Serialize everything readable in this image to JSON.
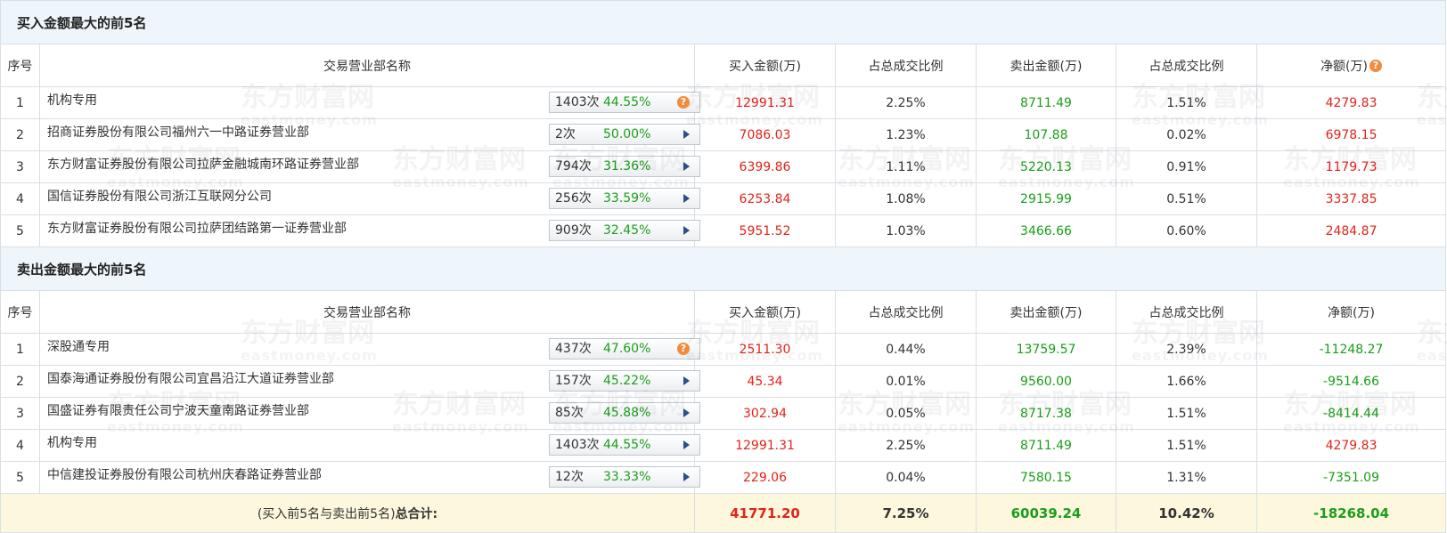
{
  "buy_section": {
    "title": "买入金额最大的前5名",
    "headers": {
      "idx": "序号",
      "name": "交易营业部名称",
      "buy": "买入金额(万)",
      "buy_pct": "占总成交比例",
      "sell": "卖出金额(万)",
      "sell_pct": "占总成交比例",
      "net": "净额(万)"
    },
    "rows": [
      {
        "idx": "1",
        "name": "机构专用",
        "count": "1403次",
        "rate": "44.55%",
        "buy": "12991.31",
        "buy_pct": "2.25%",
        "sell": "8711.49",
        "sell_pct": "1.51%",
        "net": "4279.83"
      },
      {
        "idx": "2",
        "name": "招商证券股份有限公司福州六一中路证券营业部",
        "count": "2次",
        "rate": "50.00%",
        "buy": "7086.03",
        "buy_pct": "1.23%",
        "sell": "107.88",
        "sell_pct": "0.02%",
        "net": "6978.15"
      },
      {
        "idx": "3",
        "name": "东方财富证券股份有限公司拉萨金融城南环路证券营业部",
        "count": "794次",
        "rate": "31.36%",
        "buy": "6399.86",
        "buy_pct": "1.11%",
        "sell": "5220.13",
        "sell_pct": "0.91%",
        "net": "1179.73"
      },
      {
        "idx": "4",
        "name": "国信证券股份有限公司浙江互联网分公司",
        "count": "256次",
        "rate": "33.59%",
        "buy": "6253.84",
        "buy_pct": "1.08%",
        "sell": "2915.99",
        "sell_pct": "0.51%",
        "net": "3337.85"
      },
      {
        "idx": "5",
        "name": "东方财富证券股份有限公司拉萨团结路第一证券营业部",
        "count": "909次",
        "rate": "32.45%",
        "buy": "5951.52",
        "buy_pct": "1.03%",
        "sell": "3466.66",
        "sell_pct": "0.60%",
        "net": "2484.87"
      }
    ]
  },
  "sell_section": {
    "title": "卖出金额最大的前5名",
    "headers": {
      "idx": "序号",
      "name": "交易营业部名称",
      "buy": "买入金额(万)",
      "buy_pct": "占总成交比例",
      "sell": "卖出金额(万)",
      "sell_pct": "占总成交比例",
      "net": "净额(万)"
    },
    "rows": [
      {
        "idx": "1",
        "name": "深股通专用",
        "count": "437次",
        "rate": "47.60%",
        "buy": "2511.30",
        "buy_pct": "0.44%",
        "sell": "13759.57",
        "sell_pct": "2.39%",
        "net": "-11248.27"
      },
      {
        "idx": "2",
        "name": "国泰海通证券股份有限公司宜昌沿江大道证券营业部",
        "count": "157次",
        "rate": "45.22%",
        "buy": "45.34",
        "buy_pct": "0.01%",
        "sell": "9560.00",
        "sell_pct": "1.66%",
        "net": "-9514.66"
      },
      {
        "idx": "3",
        "name": "国盛证券有限责任公司宁波天童南路证券营业部",
        "count": "85次",
        "rate": "45.88%",
        "buy": "302.94",
        "buy_pct": "0.05%",
        "sell": "8717.38",
        "sell_pct": "1.51%",
        "net": "-8414.44"
      },
      {
        "idx": "4",
        "name": "机构专用",
        "count": "1403次",
        "rate": "44.55%",
        "buy": "12991.31",
        "buy_pct": "2.25%",
        "sell": "8711.49",
        "sell_pct": "1.51%",
        "net": "4279.83"
      },
      {
        "idx": "5",
        "name": "中信建投证券股份有限公司杭州庆春路证券营业部",
        "count": "12次",
        "rate": "33.33%",
        "buy": "229.06",
        "buy_pct": "0.04%",
        "sell": "7580.15",
        "sell_pct": "1.31%",
        "net": "-7351.09"
      }
    ]
  },
  "total": {
    "label_prefix": "(买入前5名与卖出前5名)",
    "label_bold": "总合计:",
    "buy": "41771.20",
    "buy_pct": "7.25%",
    "sell": "60039.24",
    "sell_pct": "10.42%",
    "net": "-18268.04"
  },
  "watermark": {
    "main": "东方财富网",
    "sub": "eastmoney.com"
  },
  "colors": {
    "up": "#e2231a",
    "down": "#1a9e1a",
    "section_bg": "#eef5fb",
    "total_bg": "#fdf8dd",
    "help_icon": "#f28b3b"
  }
}
